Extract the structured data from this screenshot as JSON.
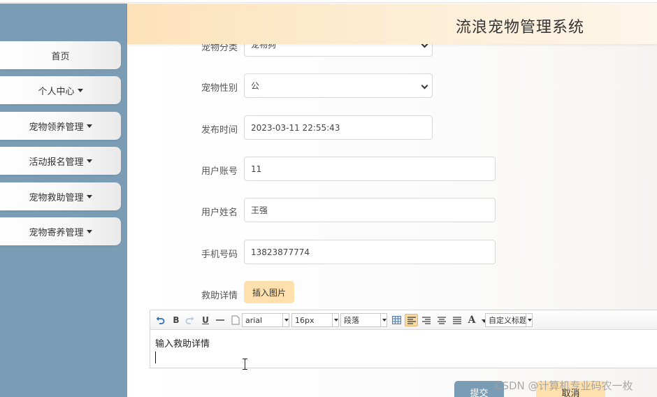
{
  "app": {
    "title": "流浪宠物管理系统"
  },
  "sidebar": {
    "items": [
      {
        "label": "首页",
        "has_caret": false
      },
      {
        "label": "个人中心",
        "has_caret": true
      },
      {
        "label": "宠物领养管理",
        "has_caret": true
      },
      {
        "label": "活动报名管理",
        "has_caret": true
      },
      {
        "label": "宠物救助管理",
        "has_caret": true
      },
      {
        "label": "宠物寄养管理",
        "has_caret": true
      }
    ]
  },
  "form": {
    "pet_category": {
      "label": "宠物分类",
      "value": "宠物狗"
    },
    "pet_gender": {
      "label": "宠物性别",
      "value": "公"
    },
    "publish_time": {
      "label": "发布时间",
      "value": "2023-03-11 22:55:43"
    },
    "user_account": {
      "label": "用户账号",
      "value": "11"
    },
    "user_name": {
      "label": "用户姓名",
      "value": "王强"
    },
    "phone": {
      "label": "手机号码",
      "value": "13823877774"
    },
    "rescue_details": {
      "label": "救助详情",
      "insert_image_label": "插入图片"
    }
  },
  "editor": {
    "toolbar": {
      "font_family": "arial",
      "font_size": "16px",
      "paragraph": "段落",
      "custom_heading": "自定义标题",
      "bold": "B",
      "underline": "U",
      "font_color": "A"
    },
    "content_text": "输入救助详情"
  },
  "actions": {
    "submit_label": "提交",
    "cancel_label": "取消"
  },
  "watermark": "CSDN @计算机专业码农一枚",
  "colors": {
    "sidebar": "#7a9cb4",
    "accent": "#fde0ad",
    "header_gradient_start": "#fde2b9"
  }
}
